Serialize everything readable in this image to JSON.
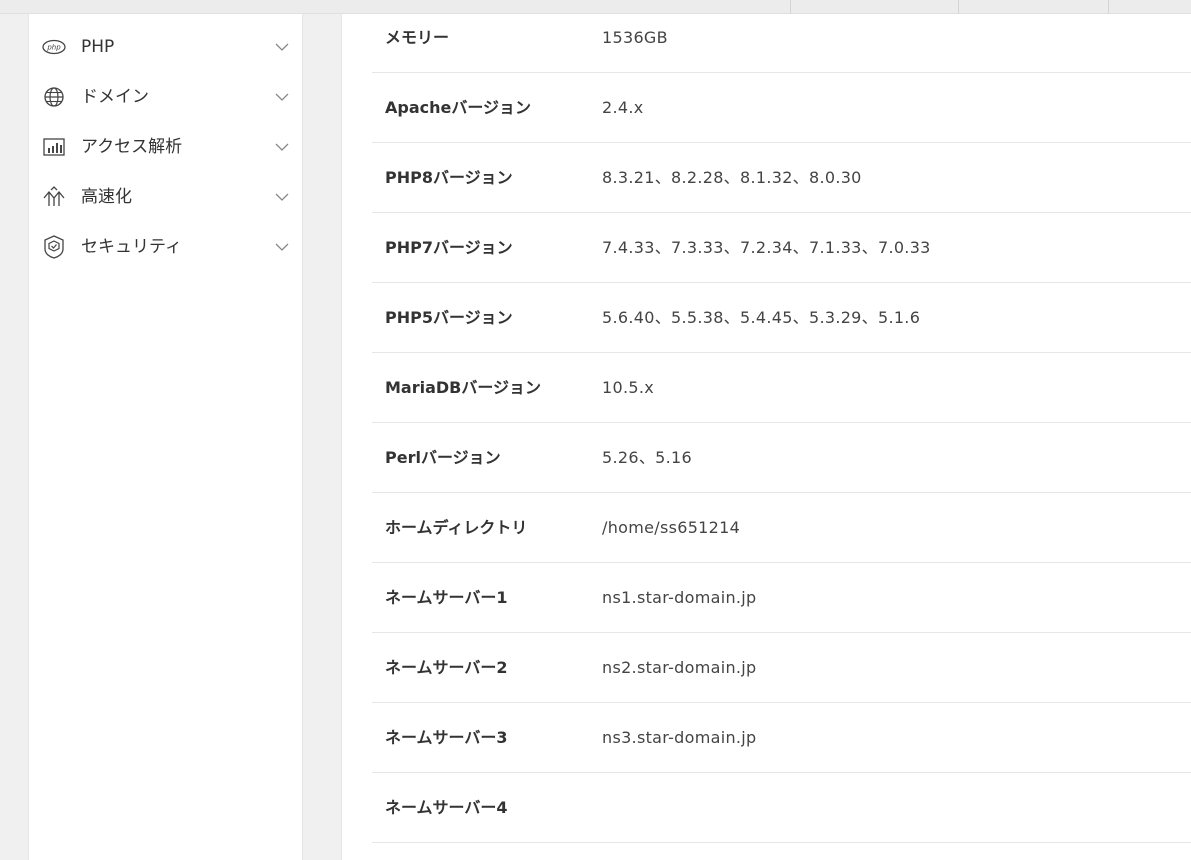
{
  "sidebar": {
    "items": [
      {
        "label": "PHP",
        "icon": "php-icon"
      },
      {
        "label": "ドメイン",
        "icon": "globe-icon"
      },
      {
        "label": "アクセス解析",
        "icon": "chart-icon"
      },
      {
        "label": "高速化",
        "icon": "speed-icon"
      },
      {
        "label": "セキュリティ",
        "icon": "shield-icon"
      }
    ]
  },
  "server_info": {
    "rows": [
      {
        "key": "メモリー",
        "value": "1536GB"
      },
      {
        "key": "Apacheバージョン",
        "value": "2.4.x"
      },
      {
        "key": "PHP8バージョン",
        "value": "8.3.21、8.2.28、8.1.32、8.0.30"
      },
      {
        "key": "PHP7バージョン",
        "value": "7.4.33、7.3.33、7.2.34、7.1.33、7.0.33"
      },
      {
        "key": "PHP5バージョン",
        "value": "5.6.40、5.5.38、5.4.45、5.3.29、5.1.6"
      },
      {
        "key": "MariaDBバージョン",
        "value": "10.5.x"
      },
      {
        "key": "Perlバージョン",
        "value": "5.26、5.16"
      },
      {
        "key": "ホームディレクトリ",
        "value": "/home/ss651214"
      },
      {
        "key": "ネームサーバー1",
        "value": "ns1.star-domain.jp"
      },
      {
        "key": "ネームサーバー2",
        "value": "ns2.star-domain.jp"
      },
      {
        "key": "ネームサーバー3",
        "value": "ns3.star-domain.jp"
      },
      {
        "key": "ネームサーバー4",
        "value": ""
      }
    ]
  }
}
